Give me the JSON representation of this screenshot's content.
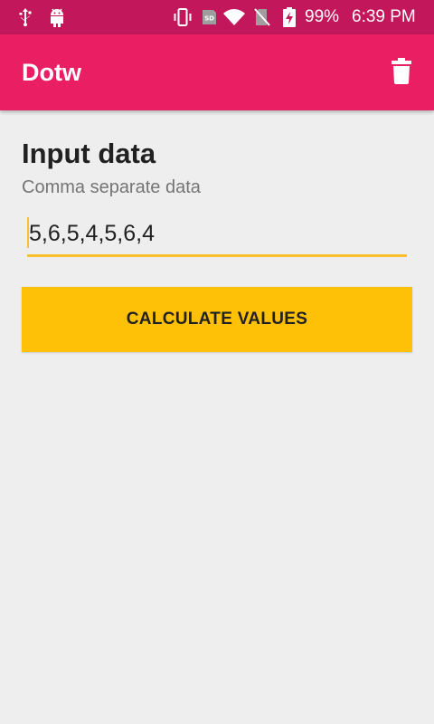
{
  "status_bar": {
    "battery_percent": "99%",
    "time": "6:39 PM",
    "sd_label": "SD",
    "icons": [
      "usb-icon",
      "android-icon",
      "vibrate-icon",
      "sd-card-icon",
      "wifi-icon",
      "no-sim-icon",
      "battery-charging-icon"
    ],
    "background_color": "#c2185b"
  },
  "app_bar": {
    "title": "Dotw",
    "action_icon": "delete-icon",
    "background_color": "#e91e63"
  },
  "main": {
    "heading": "Input data",
    "subheading": "Comma separate data",
    "input": {
      "value": "5,6,5,4,5,6,4",
      "accent_color": "#fbc02d"
    },
    "calculate_button": {
      "label": "CALCULATE VALUES",
      "color": "#ffc107"
    }
  }
}
